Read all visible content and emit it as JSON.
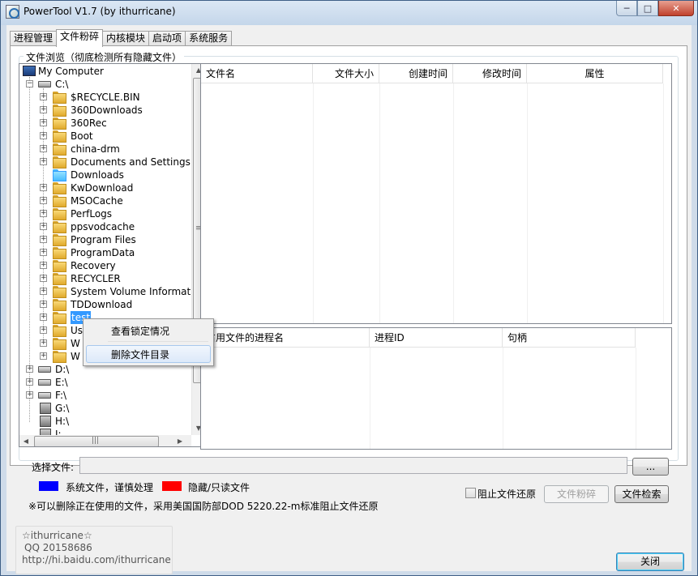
{
  "window": {
    "title": "PowerTool V1.7 (by ithurricane)",
    "controls": {
      "minimize": "─",
      "maximize": "□",
      "close": "✕"
    }
  },
  "tabs": [
    {
      "label": "进程管理",
      "active": false
    },
    {
      "label": "文件粉碎",
      "active": true
    },
    {
      "label": "内核模块",
      "active": false
    },
    {
      "label": "启动项",
      "active": false
    },
    {
      "label": "系统服务",
      "active": false
    }
  ],
  "group_label": "文件浏览（彻底检测所有隐藏文件）",
  "tree": {
    "root": "My Computer",
    "drive_c": "C:\\",
    "folders": [
      "$RECYCLE.BIN",
      "360Downloads",
      "360Rec",
      "Boot",
      "china-drm",
      "Documents and Settings",
      "Downloads",
      "KwDownload",
      "MSOCache",
      "PerfLogs",
      "ppsvodcache",
      "Program Files",
      "ProgramData",
      "Recovery",
      "RECYCLER",
      "System Volume Informat",
      "TDDownload",
      "test",
      "Us",
      "W",
      "W"
    ],
    "selected_folder": "test",
    "drives": [
      "D:\\",
      "E:\\",
      "F:\\",
      "G:\\",
      "H:\\",
      "I:"
    ]
  },
  "file_list": {
    "columns": [
      "文件名",
      "文件大小",
      "创建时间",
      "修改时间",
      "属性"
    ]
  },
  "lock_list": {
    "columns": [
      "占用文件的进程名",
      "进程ID",
      "句柄"
    ]
  },
  "context_menu": {
    "items": [
      "查看锁定情况",
      "删除文件目录"
    ],
    "hover_index": 1
  },
  "select_file": {
    "label": "选择文件:",
    "value": "",
    "browse_label": "..."
  },
  "legend": {
    "system_label": "系统文件，谨慎处理",
    "system_color": "#0000ff",
    "hidden_label": "隐藏/只读文件",
    "hidden_color": "#ff0000"
  },
  "note": "※可以删除正在使用的文件，采用美国国防部DOD 5220.22-m标准阻止文件还原",
  "options": {
    "prevent_restore_label": "阻止文件还原",
    "prevent_restore_checked": false
  },
  "buttons": {
    "shred": "文件粉碎",
    "search": "文件检索",
    "close": "关闭"
  },
  "info": {
    "author": "☆ithurricane☆",
    "qq": "QQ 20158686",
    "url": "http://hi.baidu.com/ithurricane"
  }
}
